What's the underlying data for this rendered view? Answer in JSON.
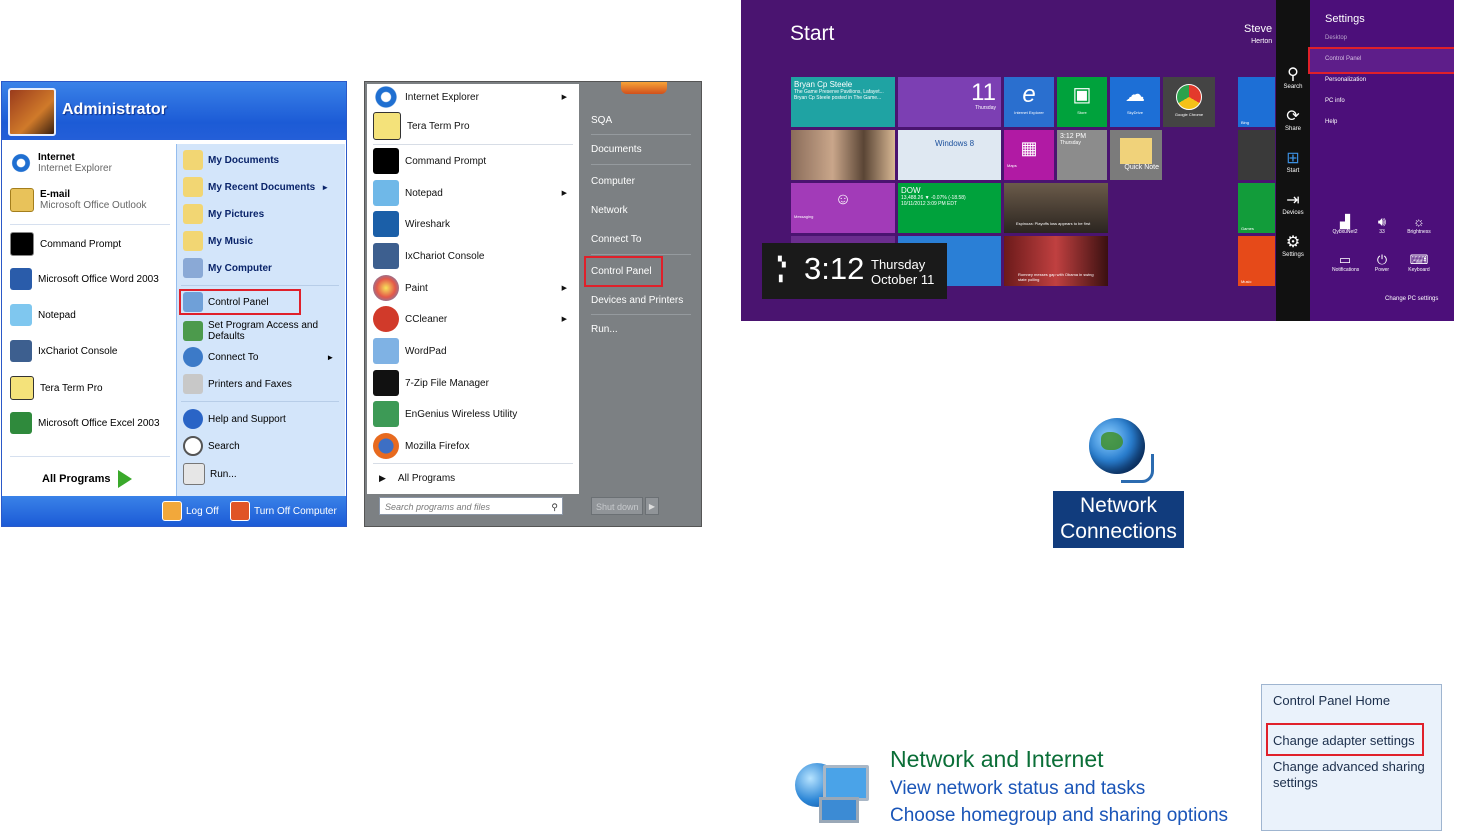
{
  "xp": {
    "user": "Administrator",
    "pinned": [
      {
        "title": "Internet",
        "subtitle": "Internet Explorer",
        "icon": "internet-explorer-icon"
      },
      {
        "title": "E-mail",
        "subtitle": "Microsoft Office Outlook",
        "icon": "outlook-icon"
      }
    ],
    "recent": [
      {
        "label": "Command Prompt",
        "icon": "command-prompt-icon"
      },
      {
        "label": "Microsoft Office Word 2003",
        "icon": "word-icon"
      },
      {
        "label": "Notepad",
        "icon": "notepad-icon"
      },
      {
        "label": "IxChariot Console",
        "icon": "ixchariot-icon"
      },
      {
        "label": "Tera Term Pro",
        "icon": "tera-term-icon"
      },
      {
        "label": "Microsoft Office Excel 2003",
        "icon": "excel-icon"
      }
    ],
    "all_programs": "All Programs",
    "right": [
      {
        "label": "My Documents",
        "icon": "folder-icon"
      },
      {
        "label": "My Recent Documents",
        "icon": "recent-folder-icon"
      },
      {
        "label": "My Pictures",
        "icon": "pictures-icon"
      },
      {
        "label": "My Music",
        "icon": "music-icon"
      },
      {
        "label": "My Computer",
        "icon": "computer-icon"
      },
      {
        "label": "Control Panel",
        "icon": "control-panel-icon"
      },
      {
        "label": "Set Program Access and Defaults",
        "icon": "program-access-icon"
      },
      {
        "label": "Connect To",
        "icon": "connect-icon"
      },
      {
        "label": "Printers and Faxes",
        "icon": "printer-icon"
      },
      {
        "label": "Help and Support",
        "icon": "help-icon"
      },
      {
        "label": "Search",
        "icon": "search-icon"
      },
      {
        "label": "Run...",
        "icon": "run-icon"
      }
    ],
    "logoff": "Log Off",
    "turnoff": "Turn Off Computer"
  },
  "w7": {
    "programs": [
      {
        "label": "Internet Explorer",
        "icon": "internet-explorer-icon"
      },
      {
        "label": "Tera Term Pro",
        "icon": "tera-term-icon"
      },
      {
        "label": "Command Prompt",
        "icon": "command-prompt-icon"
      },
      {
        "label": "Notepad",
        "icon": "notepad-icon"
      },
      {
        "label": "Wireshark",
        "icon": "wireshark-icon"
      },
      {
        "label": "IxChariot Console",
        "icon": "ixchariot-icon"
      },
      {
        "label": "Paint",
        "icon": "paint-icon"
      },
      {
        "label": "CCleaner",
        "icon": "ccleaner-icon"
      },
      {
        "label": "WordPad",
        "icon": "wordpad-icon"
      },
      {
        "label": "7-Zip File Manager",
        "icon": "7zip-icon"
      },
      {
        "label": "EnGenius Wireless Utility",
        "icon": "engenius-icon"
      },
      {
        "label": "Mozilla Firefox",
        "icon": "firefox-icon"
      }
    ],
    "all_programs": "All Programs",
    "search_placeholder": "Search programs and files",
    "right": [
      "SQA",
      "Documents",
      "Computer",
      "Network",
      "Connect To",
      "Control Panel",
      "Devices and Printers",
      "Run..."
    ],
    "shutdown": "Shut down"
  },
  "w8": {
    "title": "Start",
    "user": "Steve",
    "user_sub": "Herton",
    "tiles": {
      "people_title": "Bryan Cp Steele",
      "people_text": "The Game Preserve Pavilions, Lafayet... Bryan Cp Steele posted in The Game...",
      "calendar_num": "11",
      "calendar_day": "Thursday",
      "ie": "Internet Explorer",
      "store": "Store",
      "skydrive": "SkyDrive",
      "chrome": "Google Chrome",
      "win8": "Windows 8",
      "maps": "Maps",
      "clock_time": "3:12 PM",
      "clock_day": "Thursday",
      "quicknote": "Quick Note",
      "messaging": "Messaging",
      "dow": "DOW",
      "dow_text": "13,488.26 ▼ -0.07% (-18.58)",
      "dow_date": "10/11/2012 3:09 PM EDT",
      "sports_text": "Espinoza: Playoffs loss appears to be first",
      "news_text": "Romney messes gap with Obama in swing state polling",
      "bing": "Bing",
      "games": "Games",
      "music": "Music"
    },
    "lock": {
      "time": "3:12",
      "day": "Thursday",
      "date": "October 11"
    },
    "charms": [
      "Search",
      "Share",
      "Start",
      "Devices",
      "Settings"
    ],
    "settings": {
      "title": "Settings",
      "items": [
        "Desktop",
        "Control Panel",
        "Personalization",
        "PC info",
        "Help"
      ],
      "quick": [
        "QybxuNet2",
        "33",
        "Brightness",
        "Notifications",
        "Power",
        "Keyboard"
      ],
      "change": "Change PC settings"
    }
  },
  "network_connections": {
    "line1": "Network",
    "line2": "Connections"
  },
  "network_internet": {
    "title": "Network and Internet",
    "link1": "View network status and tasks",
    "link2": "Choose homegroup and sharing options"
  },
  "control_panel": {
    "home": "Control Panel Home",
    "adapter": "Change adapter settings",
    "sharing": "Change advanced sharing settings"
  },
  "colors": {
    "highlight": "#e0202a",
    "xp_blue": "#1c5bd6",
    "win8_purple": "#4a1470"
  }
}
